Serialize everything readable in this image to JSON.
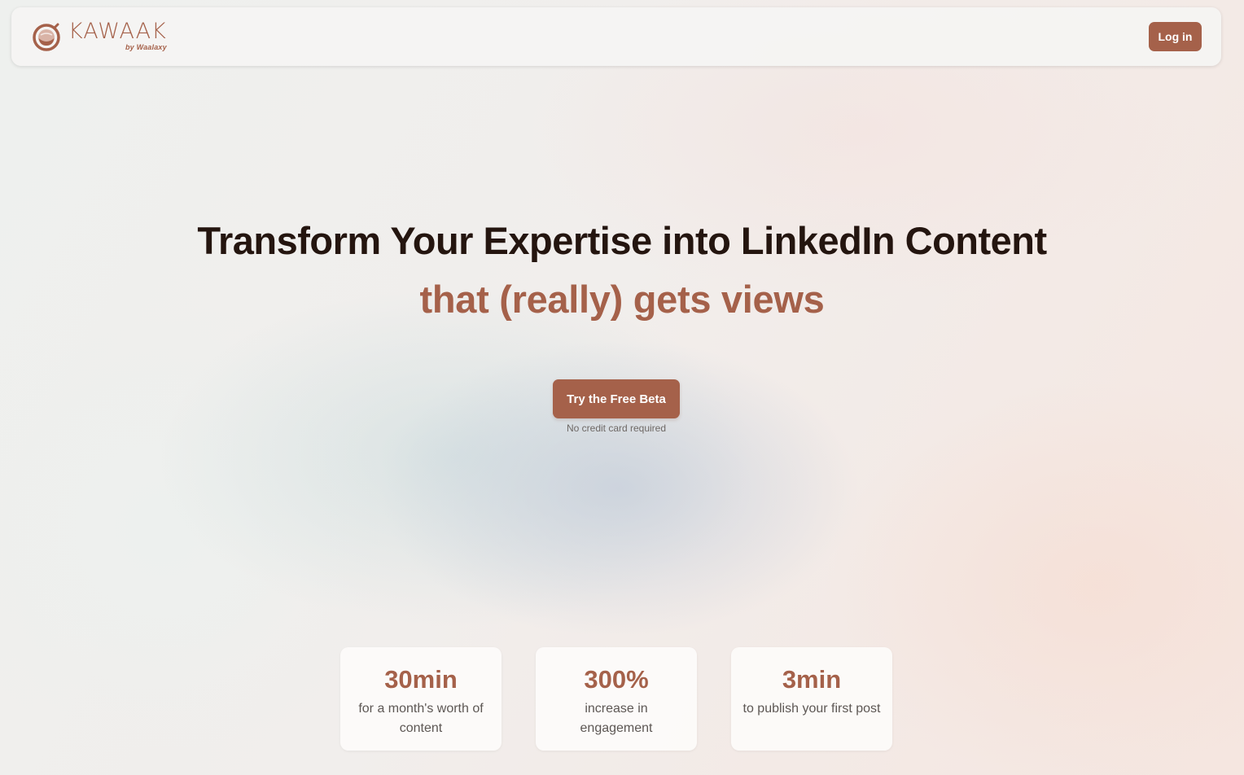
{
  "brand": {
    "name": "KAWAAK",
    "byline": "by Waalaxy",
    "color": "#a5614a"
  },
  "header": {
    "login_label": "Log in"
  },
  "hero": {
    "title": "Transform Your Expertise into LinkedIn Content",
    "subtitle": "that (really) gets views",
    "cta_label": "Try the Free Beta",
    "cta_note": "No credit card required"
  },
  "stats": [
    {
      "value": "30min",
      "label": "for a month's worth of content"
    },
    {
      "value": "300%",
      "label": "increase in engagement"
    },
    {
      "value": "3min",
      "label": "to publish your first post"
    }
  ]
}
